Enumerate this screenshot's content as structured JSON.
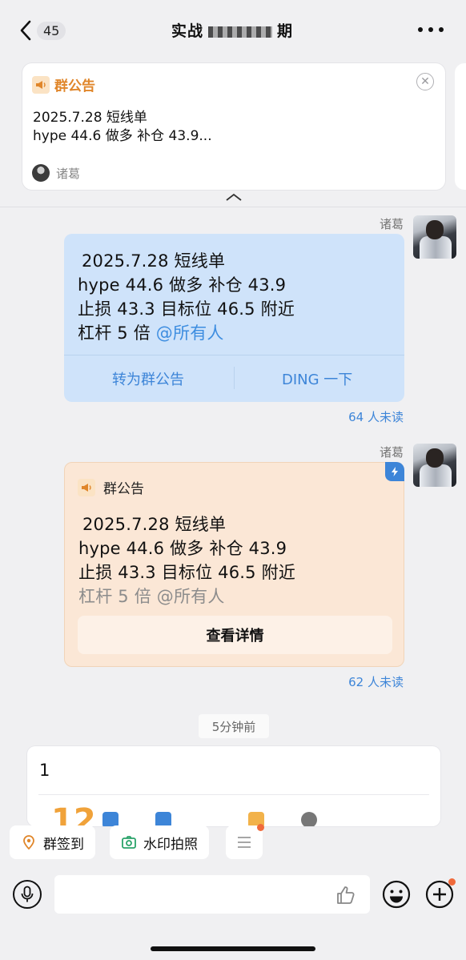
{
  "header": {
    "back_count": "45",
    "title_start": "实战",
    "title_end": "期"
  },
  "pinned_notice": {
    "label": "群公告",
    "line1": "2025.7.28 短线单",
    "line2": "hype  44.6 做多   补仓 43.9...",
    "author": "诸葛"
  },
  "messages": {
    "msg1": {
      "sender": "诸葛",
      "line1": "2025.7.28 短线单",
      "line2": "hype  44.6 做多   补仓 43.9",
      "line3": "止损 43.3   目标位 46.5 附近",
      "line4_prefix": "杠杆 5 倍 ",
      "mention": "@所有人",
      "action_left": "转为群公告",
      "action_right": "DING 一下",
      "read_status": "64 人未读"
    },
    "msg2": {
      "sender": "诸葛",
      "label": "群公告",
      "line1": "2025.7.28 短线单",
      "line2": "hype  44.6 做多   补仓 43.9",
      "line3": "止损 43.3   目标位 46.5 附近",
      "line4": "杠杆 5 倍 @所有人",
      "detail_button": "查看详情",
      "read_status": "62 人未读"
    },
    "time_divider": "5分钟前",
    "msg3": {
      "text": "1"
    }
  },
  "quick_actions": {
    "checkin": "群签到",
    "watermark_photo": "水印拍照"
  },
  "input": {
    "placeholder": ""
  },
  "colors": {
    "accent_blue": "#3d85d8",
    "notice_orange": "#e0862a",
    "blue_bubble": "#cfe3fa",
    "orange_bubble": "#fbe7d6"
  }
}
